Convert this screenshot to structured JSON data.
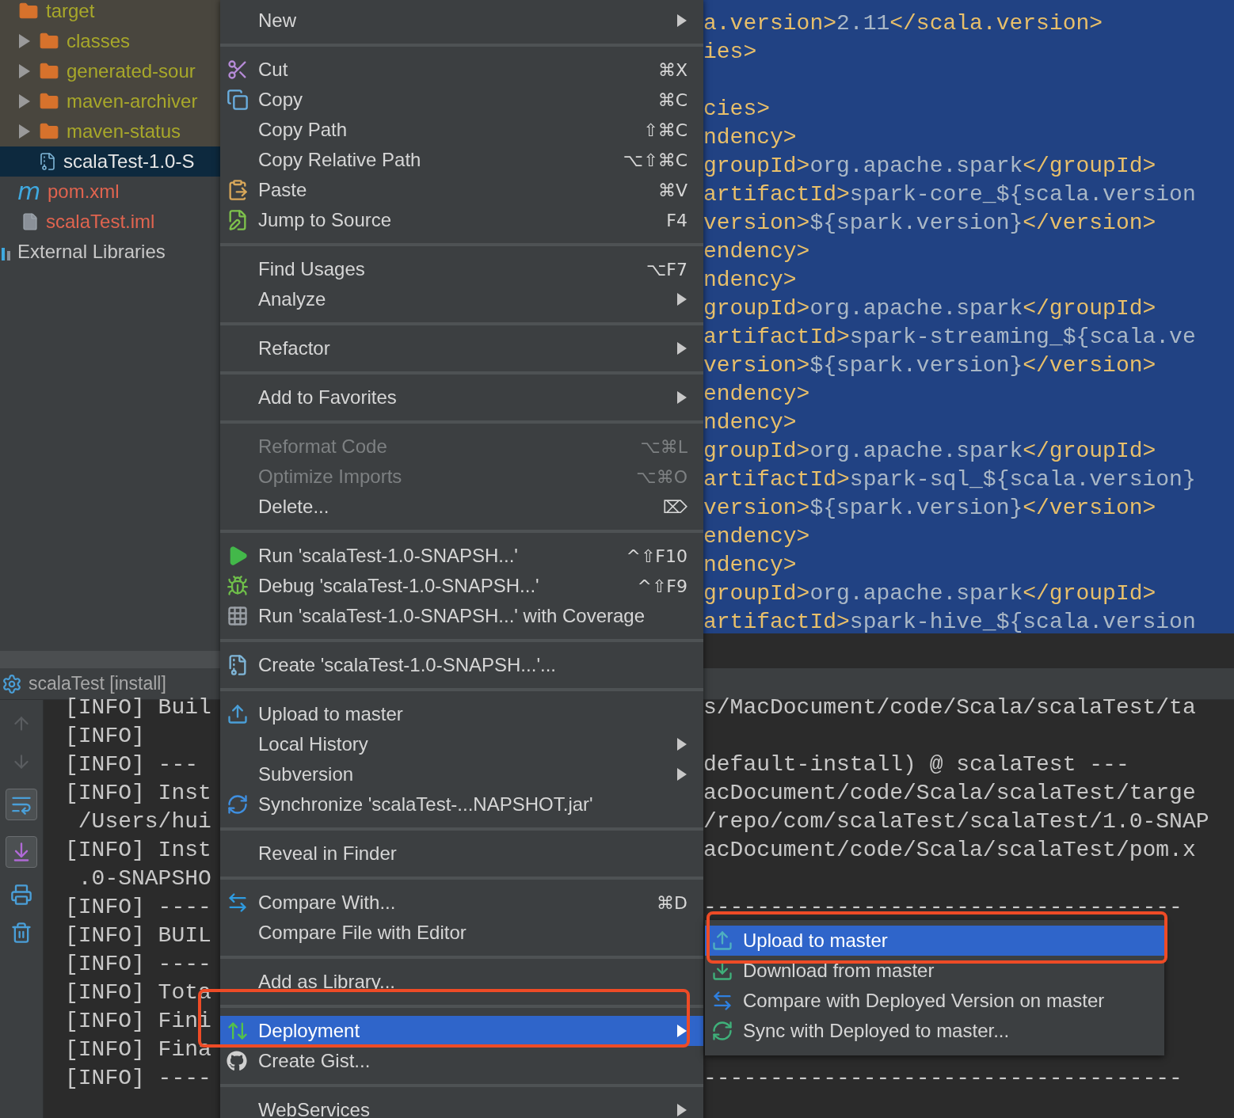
{
  "project_tree": [
    {
      "label": "target",
      "kind": "excluded",
      "selected": false,
      "children": [
        {
          "label": "classes",
          "kind": "excluded",
          "expanded": false,
          "selected": false
        },
        {
          "label": "generated-sour",
          "kind": "excluded",
          "expanded": false,
          "selected": false
        },
        {
          "label": "maven-archiver",
          "kind": "excluded",
          "expanded": false,
          "selected": false
        },
        {
          "label": "maven-status",
          "kind": "excluded",
          "expanded": false,
          "selected": false
        },
        {
          "label": "scalaTest-1.0-S",
          "kind": "normal",
          "selected": true
        }
      ]
    },
    {
      "label": "pom.xml",
      "kind": "unversioned",
      "selected": false,
      "icon_letter": "m"
    },
    {
      "label": "scalaTest.iml",
      "kind": "unversioned",
      "selected": false
    },
    {
      "label": "External Libraries",
      "kind": "normal",
      "selected": false
    }
  ],
  "editor_lines": [
    {
      "blank_before": false,
      "segments": [
        {
          "kind": "tag",
          "text": "a.version>"
        },
        {
          "kind": "text",
          "text": "2.11"
        },
        {
          "kind": "tag",
          "text": "</scala.version>"
        }
      ]
    },
    {
      "blank_before": false,
      "segments": [
        {
          "kind": "tag",
          "text": "ies>"
        }
      ]
    },
    {
      "blank_before": true,
      "segments": [
        {
          "kind": "tag",
          "text": "cies>"
        }
      ]
    },
    {
      "blank_before": false,
      "segments": [
        {
          "kind": "tag",
          "text": "ndency>"
        }
      ]
    },
    {
      "blank_before": false,
      "segments": [
        {
          "kind": "tag",
          "text": "groupId>"
        },
        {
          "kind": "text",
          "text": "org.apache.spark"
        },
        {
          "kind": "tag",
          "text": "</groupId>"
        }
      ]
    },
    {
      "blank_before": false,
      "segments": [
        {
          "kind": "tag",
          "text": "artifactId>"
        },
        {
          "kind": "text",
          "text": "spark-core_${scala.version"
        }
      ]
    },
    {
      "blank_before": false,
      "segments": [
        {
          "kind": "tag",
          "text": "version>"
        },
        {
          "kind": "text",
          "text": "${spark.version}"
        },
        {
          "kind": "tag",
          "text": "</version>"
        }
      ]
    },
    {
      "blank_before": false,
      "segments": [
        {
          "kind": "tag",
          "text": "endency>"
        }
      ]
    },
    {
      "blank_before": false,
      "segments": [
        {
          "kind": "tag",
          "text": "ndency>"
        }
      ]
    },
    {
      "blank_before": false,
      "segments": [
        {
          "kind": "tag",
          "text": "groupId>"
        },
        {
          "kind": "text",
          "text": "org.apache.spark"
        },
        {
          "kind": "tag",
          "text": "</groupId>"
        }
      ]
    },
    {
      "blank_before": false,
      "segments": [
        {
          "kind": "tag",
          "text": "artifactId>"
        },
        {
          "kind": "text",
          "text": "spark-streaming_${scala.ve"
        }
      ]
    },
    {
      "blank_before": false,
      "segments": [
        {
          "kind": "tag",
          "text": "version>"
        },
        {
          "kind": "text",
          "text": "${spark.version}"
        },
        {
          "kind": "tag",
          "text": "</version>"
        }
      ]
    },
    {
      "blank_before": false,
      "segments": [
        {
          "kind": "tag",
          "text": "endency>"
        }
      ]
    },
    {
      "blank_before": false,
      "segments": [
        {
          "kind": "tag",
          "text": "ndency>"
        }
      ]
    },
    {
      "blank_before": false,
      "segments": [
        {
          "kind": "tag",
          "text": "groupId>"
        },
        {
          "kind": "text",
          "text": "org.apache.spark"
        },
        {
          "kind": "tag",
          "text": "</groupId>"
        }
      ]
    },
    {
      "blank_before": false,
      "segments": [
        {
          "kind": "tag",
          "text": "artifactId>"
        },
        {
          "kind": "text",
          "text": "spark-sql_${scala.version}"
        }
      ]
    },
    {
      "blank_before": false,
      "segments": [
        {
          "kind": "tag",
          "text": "version>"
        },
        {
          "kind": "text",
          "text": "${spark.version}"
        },
        {
          "kind": "tag",
          "text": "</version>"
        }
      ]
    },
    {
      "blank_before": false,
      "segments": [
        {
          "kind": "tag",
          "text": "endency>"
        }
      ]
    },
    {
      "blank_before": false,
      "segments": [
        {
          "kind": "tag",
          "text": "ndency>"
        }
      ]
    },
    {
      "blank_before": false,
      "segments": [
        {
          "kind": "tag",
          "text": "groupId>"
        },
        {
          "kind": "text",
          "text": "org.apache.spark"
        },
        {
          "kind": "tag",
          "text": "</groupId>"
        }
      ]
    },
    {
      "blank_before": false,
      "segments": [
        {
          "kind": "tag",
          "text": "artifactId>"
        },
        {
          "kind": "text",
          "text": "spark-hive_${scala.version"
        }
      ]
    }
  ],
  "run_panel": {
    "title": "scalaTest [install]",
    "console_lines": [
      {
        "left": "[INFO] Buil",
        "right": "s/MacDocument/code/Scala/scalaTest/ta"
      },
      {
        "left": "[INFO]"
      },
      {
        "left": "[INFO] ---",
        "right": "default-install) @ scalaTest ---"
      },
      {
        "left": "[INFO] Inst",
        "right": "acDocument/code/Scala/scalaTest/targe"
      },
      {
        "left": " /Users/hui",
        "right": "/repo/com/scalaTest/scalaTest/1.0-SNAP"
      },
      {
        "left": "[INFO] Inst",
        "right": "acDocument/code/Scala/scalaTest/pom.x"
      },
      {
        "left": " .0-SNAPSHO"
      },
      {
        "left": "[INFO] ----",
        "right": "------------------------------------"
      },
      {
        "left": "[INFO] BUIL"
      },
      {
        "left": "[INFO] ----"
      },
      {
        "left": "[INFO] Tota"
      },
      {
        "left": "[INFO] Fini"
      },
      {
        "left": "[INFO] Fina"
      },
      {
        "left": "[INFO] ----",
        "right": "------------------------------------"
      }
    ]
  },
  "context_menu": [
    {
      "kind": "item",
      "label": "New",
      "has_submenu": true,
      "disabled": false,
      "selected": false
    },
    {
      "kind": "separator"
    },
    {
      "kind": "item",
      "label": "Cut",
      "shortcut": "⌘X",
      "has_submenu": false,
      "disabled": false,
      "selected": false
    },
    {
      "kind": "item",
      "label": "Copy",
      "shortcut": "⌘C",
      "has_submenu": false,
      "disabled": false,
      "selected": false
    },
    {
      "kind": "item",
      "label": "Copy Path",
      "shortcut": "⇧⌘C",
      "has_submenu": false,
      "disabled": false,
      "selected": false
    },
    {
      "kind": "item",
      "label": "Copy Relative Path",
      "shortcut": "⌥⇧⌘C",
      "has_submenu": false,
      "disabled": false,
      "selected": false
    },
    {
      "kind": "item",
      "label": "Paste",
      "shortcut": "⌘V",
      "has_submenu": false,
      "disabled": false,
      "selected": false
    },
    {
      "kind": "item",
      "label": "Jump to Source",
      "shortcut": "F4",
      "has_submenu": false,
      "disabled": false,
      "selected": false
    },
    {
      "kind": "separator"
    },
    {
      "kind": "item",
      "label": "Find Usages",
      "shortcut": "⌥F7",
      "has_submenu": false,
      "disabled": false,
      "selected": false
    },
    {
      "kind": "item",
      "label": "Analyze",
      "has_submenu": true,
      "disabled": false,
      "selected": false
    },
    {
      "kind": "separator"
    },
    {
      "kind": "item",
      "label": "Refactor",
      "has_submenu": true,
      "disabled": false,
      "selected": false
    },
    {
      "kind": "separator"
    },
    {
      "kind": "item",
      "label": "Add to Favorites",
      "has_submenu": true,
      "disabled": false,
      "selected": false
    },
    {
      "kind": "separator"
    },
    {
      "kind": "item",
      "label": "Reformat Code",
      "shortcut": "⌥⌘L",
      "has_submenu": false,
      "disabled": true,
      "selected": false
    },
    {
      "kind": "item",
      "label": "Optimize Imports",
      "shortcut": "⌥⌘O",
      "has_submenu": false,
      "disabled": true,
      "selected": false
    },
    {
      "kind": "item",
      "label": "Delete...",
      "shortcut": "⌦",
      "has_submenu": false,
      "disabled": false,
      "selected": false
    },
    {
      "kind": "separator"
    },
    {
      "kind": "item",
      "label": "Run 'scalaTest-1.0-SNAPSH...'",
      "shortcut": "^⇧F10",
      "has_submenu": false,
      "disabled": false,
      "selected": false
    },
    {
      "kind": "item",
      "label": "Debug 'scalaTest-1.0-SNAPSH...'",
      "shortcut": "^⇧F9",
      "has_submenu": false,
      "disabled": false,
      "selected": false
    },
    {
      "kind": "item",
      "label": "Run 'scalaTest-1.0-SNAPSH...' with Coverage",
      "has_submenu": false,
      "disabled": false,
      "selected": false
    },
    {
      "kind": "separator"
    },
    {
      "kind": "item",
      "label": "Create 'scalaTest-1.0-SNAPSH...'...",
      "has_submenu": false,
      "disabled": false,
      "selected": false
    },
    {
      "kind": "separator"
    },
    {
      "kind": "item",
      "label": "Upload to master",
      "has_submenu": false,
      "disabled": false,
      "selected": false
    },
    {
      "kind": "item",
      "label": "Local History",
      "has_submenu": true,
      "disabled": false,
      "selected": false
    },
    {
      "kind": "item",
      "label": "Subversion",
      "has_submenu": true,
      "disabled": false,
      "selected": false
    },
    {
      "kind": "item",
      "label": "Synchronize 'scalaTest-...NAPSHOT.jar'",
      "has_submenu": false,
      "disabled": false,
      "selected": false
    },
    {
      "kind": "separator"
    },
    {
      "kind": "item",
      "label": "Reveal in Finder",
      "has_submenu": false,
      "disabled": false,
      "selected": false
    },
    {
      "kind": "separator"
    },
    {
      "kind": "item",
      "label": "Compare With...",
      "shortcut": "⌘D",
      "has_submenu": false,
      "disabled": false,
      "selected": false
    },
    {
      "kind": "item",
      "label": "Compare File with Editor",
      "has_submenu": false,
      "disabled": false,
      "selected": false
    },
    {
      "kind": "separator"
    },
    {
      "kind": "item",
      "label": "Add as Library...",
      "has_submenu": false,
      "disabled": false,
      "selected": false
    },
    {
      "kind": "separator"
    },
    {
      "kind": "item",
      "label": "Deployment",
      "has_submenu": true,
      "disabled": false,
      "selected": true
    },
    {
      "kind": "item",
      "label": "Create Gist...",
      "has_submenu": false,
      "disabled": false,
      "selected": false
    },
    {
      "kind": "separator"
    },
    {
      "kind": "item",
      "label": "WebServices",
      "has_submenu": true,
      "disabled": false,
      "selected": false
    }
  ],
  "deployment_submenu": [
    {
      "label": "Upload to master",
      "selected": true
    },
    {
      "label": "Download from master",
      "selected": false
    },
    {
      "label": "Compare with Deployed Version on master",
      "selected": false
    },
    {
      "label": "Sync with Deployed to master...",
      "selected": false
    }
  ]
}
